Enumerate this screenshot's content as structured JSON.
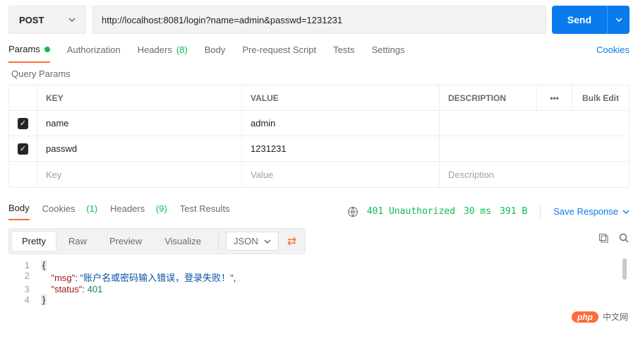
{
  "request": {
    "method": "POST",
    "url": "http://localhost:8081/login?name=admin&passwd=1231231",
    "send_label": "Send"
  },
  "tabs": {
    "params": "Params",
    "auth": "Authorization",
    "headers": "Headers",
    "headers_count": "(8)",
    "body": "Body",
    "prereq": "Pre-request Script",
    "tests": "Tests",
    "settings": "Settings",
    "cookies": "Cookies"
  },
  "query": {
    "title": "Query Params",
    "hdr_key": "KEY",
    "hdr_value": "VALUE",
    "hdr_desc": "DESCRIPTION",
    "bulk": "Bulk Edit",
    "rows": [
      {
        "enabled": true,
        "key": "name",
        "value": "admin",
        "desc": ""
      },
      {
        "enabled": true,
        "key": "passwd",
        "value": "1231231",
        "desc": ""
      }
    ],
    "ph_key": "Key",
    "ph_value": "Value",
    "ph_desc": "Description"
  },
  "response": {
    "tabs": {
      "body": "Body",
      "cookies": "Cookies",
      "cookies_n": "(1)",
      "headers": "Headers",
      "headers_n": "(9)",
      "tests": "Test Results"
    },
    "status_code": "401 Unauthorized",
    "time": "30 ms",
    "size": "391 B",
    "save": "Save Response",
    "view": {
      "pretty": "Pretty",
      "raw": "Raw",
      "preview": "Preview",
      "visualize": "Visualize",
      "lang": "JSON"
    },
    "body": {
      "msg_key": "\"msg\"",
      "msg_val": "\"账户名或密码输入错误，登录失败！\"",
      "status_key": "\"status\"",
      "status_val": "401"
    }
  },
  "watermark": {
    "pill": "php",
    "text": "中文网"
  }
}
